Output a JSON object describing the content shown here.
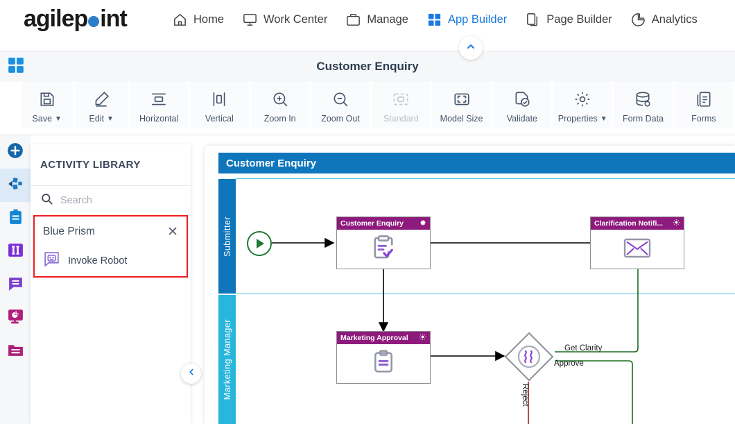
{
  "brand": {
    "name_part1": "agilep",
    "name_part2": "int",
    "accent": "#2b7fc9"
  },
  "topnav": {
    "items": [
      {
        "label": "Home",
        "icon": "home-icon",
        "active": false
      },
      {
        "label": "Work Center",
        "icon": "monitor-icon",
        "active": false
      },
      {
        "label": "Manage",
        "icon": "briefcase-icon",
        "active": false
      },
      {
        "label": "App Builder",
        "icon": "grid-icon",
        "active": true
      },
      {
        "label": "Page Builder",
        "icon": "copy-pages-icon",
        "active": false
      },
      {
        "label": "Analytics",
        "icon": "pie-chart-icon",
        "active": false
      }
    ]
  },
  "subheader": {
    "title": "Customer Enquiry",
    "grid_toggle_icon": "grid-apps-icon",
    "collapse_icon": "chevron-up-icon"
  },
  "toolbar": {
    "buttons": [
      {
        "label": "Save",
        "icon": "save-icon",
        "caret": true,
        "disabled": false
      },
      {
        "label": "Edit",
        "icon": "pencil-icon",
        "caret": true,
        "disabled": false
      },
      {
        "label": "Horizontal",
        "icon": "horizontal-align-icon",
        "caret": false,
        "disabled": false
      },
      {
        "label": "Vertical",
        "icon": "vertical-align-icon",
        "caret": false,
        "disabled": false
      },
      {
        "label": "Zoom In",
        "icon": "zoom-in-icon",
        "caret": false,
        "disabled": false
      },
      {
        "label": "Zoom Out",
        "icon": "zoom-out-icon",
        "caret": false,
        "disabled": false
      },
      {
        "label": "Standard",
        "icon": "standard-size-icon",
        "caret": false,
        "disabled": true
      },
      {
        "label": "Model Size",
        "icon": "model-size-icon",
        "caret": false,
        "disabled": false
      },
      {
        "label": "Validate",
        "icon": "validate-icon",
        "caret": false,
        "disabled": false
      },
      {
        "label": "Properties",
        "icon": "gear-icon",
        "caret": true,
        "disabled": false
      },
      {
        "label": "Form Data",
        "icon": "database-icon",
        "caret": false,
        "disabled": false
      },
      {
        "label": "Forms",
        "icon": "forms-icon",
        "caret": false,
        "disabled": false
      }
    ]
  },
  "rail": {
    "items": [
      {
        "name": "add",
        "icon": "plus-circle-icon",
        "color": "#1565a8",
        "selected": false
      },
      {
        "name": "activities",
        "icon": "activities-icon",
        "color": "#14477d",
        "selected": true
      },
      {
        "name": "tasks",
        "icon": "clipboard-icon",
        "color": "#1186d6",
        "selected": false
      },
      {
        "name": "columns",
        "icon": "columns-icon",
        "color": "#7b2fd6",
        "selected": false
      },
      {
        "name": "messages",
        "icon": "speech-bubble-icon",
        "color": "#7b3fd0",
        "selected": false
      },
      {
        "name": "reports",
        "icon": "report-monitor-icon",
        "color": "#b01f79",
        "selected": false
      },
      {
        "name": "folders",
        "icon": "folder-icon",
        "color": "#b01f79",
        "selected": false
      }
    ]
  },
  "panel": {
    "title": "ACTIVITY LIBRARY",
    "search": {
      "placeholder": "Search",
      "value": "",
      "icon": "search-icon"
    },
    "group": {
      "name": "Blue Prism",
      "close_icon": "close-icon",
      "highlight_color": "#ee1c1c",
      "activities": [
        {
          "label": "Invoke Robot",
          "icon": "robot-bubble-icon"
        }
      ]
    },
    "collapse_icon": "chevron-left-icon"
  },
  "canvas": {
    "pool_title": "Customer Enquiry",
    "pool_color": "#0f76bc",
    "lanes": [
      {
        "label": "Submitter",
        "color": "#0f76bc"
      },
      {
        "label": "Marketing Manager",
        "color": "#29b6dd"
      }
    ],
    "start_event": {
      "name": "start-event",
      "color": "#1d7a34"
    },
    "nodes": [
      {
        "id": "customer-enquiry",
        "title": "Customer Enquiry",
        "icon": "clipboard-check-icon",
        "gear": "gear-icon",
        "lane": "Submitter"
      },
      {
        "id": "clarification-notification",
        "title": "Clarification Notifi...",
        "icon": "envelope-icon",
        "gear": "gear-icon",
        "lane": "Submitter"
      },
      {
        "id": "marketing-approval",
        "title": "Marketing Approval",
        "icon": "clipboard-lines-icon",
        "gear": "gear-icon",
        "lane": "Marketing Manager"
      }
    ],
    "gateway": {
      "id": "decision-gateway",
      "icon": "complex-gateway-icon"
    },
    "edge_labels": [
      {
        "text": "Get Clarity",
        "color": "#1a6b20"
      },
      {
        "text": "Approve",
        "color": "#1a6b20"
      },
      {
        "text": "Reject",
        "color": "#a81717"
      }
    ]
  }
}
